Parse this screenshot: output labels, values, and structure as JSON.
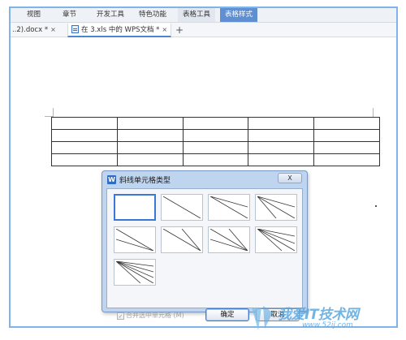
{
  "menubar": {
    "items": [
      "视图",
      "章节",
      "开发工具",
      "特色功能",
      "表格工具",
      "表格样式"
    ]
  },
  "tabs": [
    {
      "label": "..2).docx *",
      "close": "×"
    },
    {
      "label": "在 3.xls 中的 WPS文档 *",
      "close": "×"
    }
  ],
  "new_tab": "+",
  "dialog": {
    "icon_letter": "W",
    "title": "斜线单元格类型",
    "close": "X",
    "merge_label": "合并选中单元格",
    "merge_shortcut": "(M)",
    "merge_checked": true,
    "ok": "确定",
    "cancel": "取消"
  },
  "watermark": {
    "text": "我爱IT技术网",
    "url": "www.52ij.com"
  },
  "colors": {
    "accent": "#3a78d8",
    "frame": "#7fb3ea",
    "dialog_bg": "#bfd4ee",
    "context_tab": "#5f8fd0"
  }
}
